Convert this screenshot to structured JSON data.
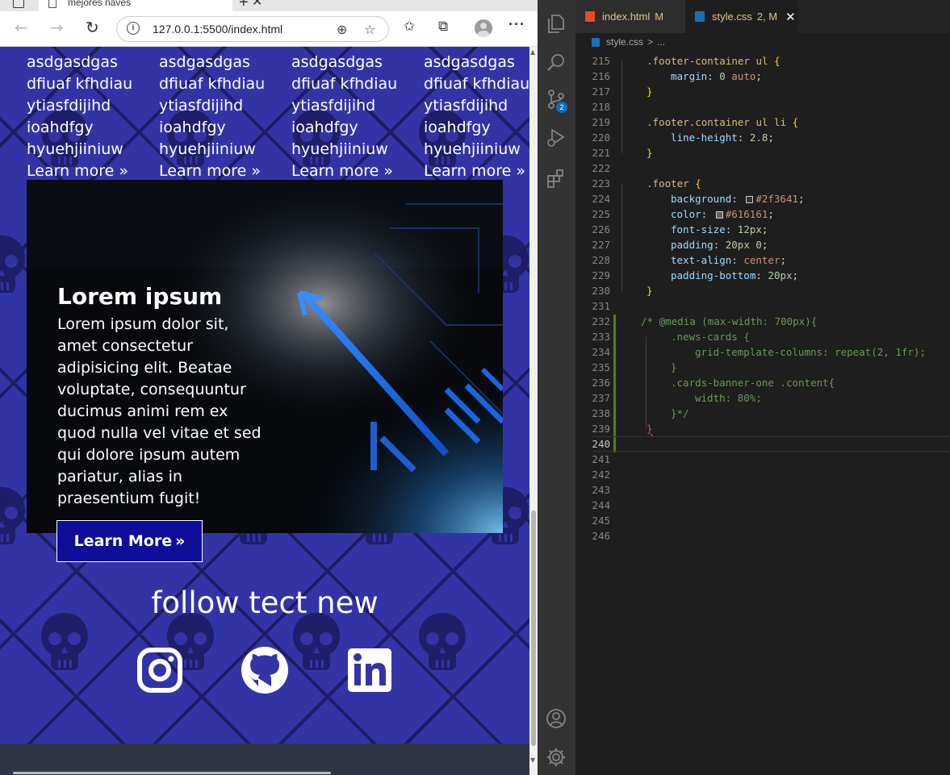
{
  "browser": {
    "tab_title": "mejores naves",
    "tab_close": "✕",
    "new_tab": "+",
    "url": "127.0.0.1:5500/index.html",
    "icons": [
      "sidebar-icon",
      "page-icon",
      "back-arrow-icon",
      "forward-arrow-icon",
      "reload-icon",
      "info-icon",
      "zoom-icon",
      "favorite-add-icon",
      "favorites-icon",
      "collections-icon",
      "profile-icon",
      "more-icon"
    ]
  },
  "page": {
    "news_columns": [
      {
        "lines": [
          "asdgasdgas",
          "dfiuaf kfhdiau",
          "ytiasfdijihd",
          "ioahdfgy",
          "hyuehjiiniuw"
        ],
        "link": "Learn more"
      },
      {
        "lines": [
          "asdgasdgas",
          "dfiuaf kfhdiau",
          "ytiasfdijihd",
          "ioahdfgy",
          "hyuehjiiniuw"
        ],
        "link": "Learn more"
      },
      {
        "lines": [
          "asdgasdgas",
          "dfiuaf kfhdiau",
          "ytiasfdijihd",
          "ioahdfgy",
          "hyuehjiiniuw"
        ],
        "link": "Learn more"
      },
      {
        "lines": [
          "asdgasdgas",
          "dfiuaf kfhdiau",
          "ytiasfdijihd",
          "ioahdfgy",
          "hyuehjiiniuw"
        ],
        "link": "Learn more"
      }
    ],
    "banner": {
      "title": "Lorem ipsum",
      "text": "Lorem ipsum dolor sit, amet consectetur adipisicing elit. Beatae voluptate, consequuntur ducimus animi rem ex quod nulla vel vitae et sed qui dolore ipsum autem pariatur, alias in praesentium fugit!",
      "button": "Learn More"
    },
    "follow_title": "follow tect new",
    "social": [
      "instagram-icon",
      "github-icon",
      "linkedin-icon"
    ],
    "colors": {
      "background": "#3234a6",
      "pattern": "#1c1d63",
      "footer": "#2f3641",
      "button": "#0f0e9a"
    }
  },
  "editor": {
    "tabs": [
      {
        "name": "index.html",
        "status": "M"
      },
      {
        "name": "style.css",
        "status": "2, M"
      }
    ],
    "tab_close": "✕",
    "breadcrumb": {
      "file": "style.css",
      "sep": ">",
      "rest": "..."
    },
    "badge_count": "2",
    "lines": [
      {
        "n": "215",
        "ind": 1,
        "t": [
          [
            "c-sel",
            ".footer-container ul "
          ],
          [
            "c-br",
            "{"
          ]
        ]
      },
      {
        "n": "216",
        "ind": 2,
        "t": [
          [
            "c-prop",
            "margin"
          ],
          [
            "c-pun",
            ": "
          ],
          [
            "c-num",
            "0"
          ],
          [
            "c-pun",
            " "
          ],
          [
            "c-val",
            "auto"
          ],
          [
            "c-pun",
            ";"
          ]
        ]
      },
      {
        "n": "217",
        "ind": 1,
        "t": [
          [
            "c-br",
            "}"
          ]
        ]
      },
      {
        "n": "218",
        "ind": 0,
        "t": []
      },
      {
        "n": "219",
        "ind": 1,
        "t": [
          [
            "c-sel",
            ".footer.container ul li "
          ],
          [
            "c-br",
            "{"
          ]
        ]
      },
      {
        "n": "220",
        "ind": 2,
        "t": [
          [
            "c-prop",
            "line-height"
          ],
          [
            "c-pun",
            ": "
          ],
          [
            "c-num",
            "2.8"
          ],
          [
            "c-pun",
            ";"
          ]
        ]
      },
      {
        "n": "221",
        "ind": 1,
        "t": [
          [
            "c-br",
            "}"
          ]
        ]
      },
      {
        "n": "222",
        "ind": 0,
        "t": []
      },
      {
        "n": "223",
        "ind": 1,
        "t": [
          [
            "c-sel",
            ".footer "
          ],
          [
            "c-br",
            "{"
          ]
        ]
      },
      {
        "n": "224",
        "ind": 2,
        "t": [
          [
            "c-prop",
            "background"
          ],
          [
            "c-pun",
            ": "
          ],
          [
            "swatch",
            "#2f3641"
          ],
          [
            "c-val",
            "#2f3641"
          ],
          [
            "c-pun",
            ";"
          ]
        ]
      },
      {
        "n": "225",
        "ind": 2,
        "t": [
          [
            "c-prop",
            "color"
          ],
          [
            "c-pun",
            ": "
          ],
          [
            "swatch",
            "#616161"
          ],
          [
            "c-val",
            "#616161"
          ],
          [
            "c-pun",
            ";"
          ]
        ]
      },
      {
        "n": "226",
        "ind": 2,
        "t": [
          [
            "c-prop",
            "font-size"
          ],
          [
            "c-pun",
            ": "
          ],
          [
            "c-num",
            "12px"
          ],
          [
            "c-pun",
            ";"
          ]
        ]
      },
      {
        "n": "227",
        "ind": 2,
        "t": [
          [
            "c-prop",
            "padding"
          ],
          [
            "c-pun",
            ": "
          ],
          [
            "c-num",
            "20px"
          ],
          [
            "c-pun",
            " "
          ],
          [
            "c-num",
            "0"
          ],
          [
            "c-pun",
            ";"
          ]
        ]
      },
      {
        "n": "228",
        "ind": 2,
        "t": [
          [
            "c-prop",
            "text-align"
          ],
          [
            "c-pun",
            ": "
          ],
          [
            "c-val",
            "center"
          ],
          [
            "c-pun",
            ";"
          ]
        ]
      },
      {
        "n": "229",
        "ind": 2,
        "t": [
          [
            "c-prop",
            "padding-bottom"
          ],
          [
            "c-pun",
            ": "
          ],
          [
            "c-num",
            "20px"
          ],
          [
            "c-pun",
            ";"
          ]
        ]
      },
      {
        "n": "230",
        "ind": 1,
        "t": [
          [
            "c-br",
            "}"
          ]
        ]
      },
      {
        "n": "231",
        "ind": 0,
        "t": []
      },
      {
        "n": "232",
        "ind": 0.75,
        "t": [
          [
            "c-com",
            "/* @media (max-width: 700px){"
          ]
        ]
      },
      {
        "n": "233",
        "ind": 2,
        "t": [
          [
            "c-com",
            ".news-cards {"
          ]
        ]
      },
      {
        "n": "234",
        "ind": 3,
        "t": [
          [
            "c-com",
            "grid-template-columns: repeat(2, 1fr);"
          ]
        ]
      },
      {
        "n": "235",
        "ind": 2,
        "t": [
          [
            "c-com",
            "}"
          ]
        ]
      },
      {
        "n": "236",
        "ind": 2,
        "t": [
          [
            "c-com",
            ".cards-banner-one .content{"
          ]
        ]
      },
      {
        "n": "237",
        "ind": 3,
        "t": [
          [
            "c-com",
            "width: 80%;"
          ]
        ]
      },
      {
        "n": "238",
        "ind": 2,
        "t": [
          [
            "c-com",
            "}*/"
          ]
        ]
      },
      {
        "n": "239",
        "ind": 1,
        "t": [
          [
            "c-err",
            "}"
          ]
        ]
      },
      {
        "n": "240",
        "ind": 0,
        "t": [],
        "current": true
      },
      {
        "n": "241",
        "ind": 0,
        "t": []
      },
      {
        "n": "242",
        "ind": 0,
        "t": []
      },
      {
        "n": "243",
        "ind": 0,
        "t": []
      },
      {
        "n": "244",
        "ind": 0,
        "t": []
      },
      {
        "n": "245",
        "ind": 0,
        "t": []
      },
      {
        "n": "246",
        "ind": 0,
        "t": []
      }
    ],
    "activity_icons": [
      "explorer-icon",
      "search-icon",
      "source-control-icon",
      "run-debug-icon",
      "extensions-icon",
      "accounts-icon",
      "settings-gear-icon"
    ],
    "colors": {
      "editor_bg": "#1e1e1e",
      "activity_bg": "#333333",
      "selector": "#d7ba7d",
      "property": "#9cdcfe",
      "string": "#ce9178",
      "number": "#b5cea8",
      "comment": "#6a9955"
    }
  }
}
